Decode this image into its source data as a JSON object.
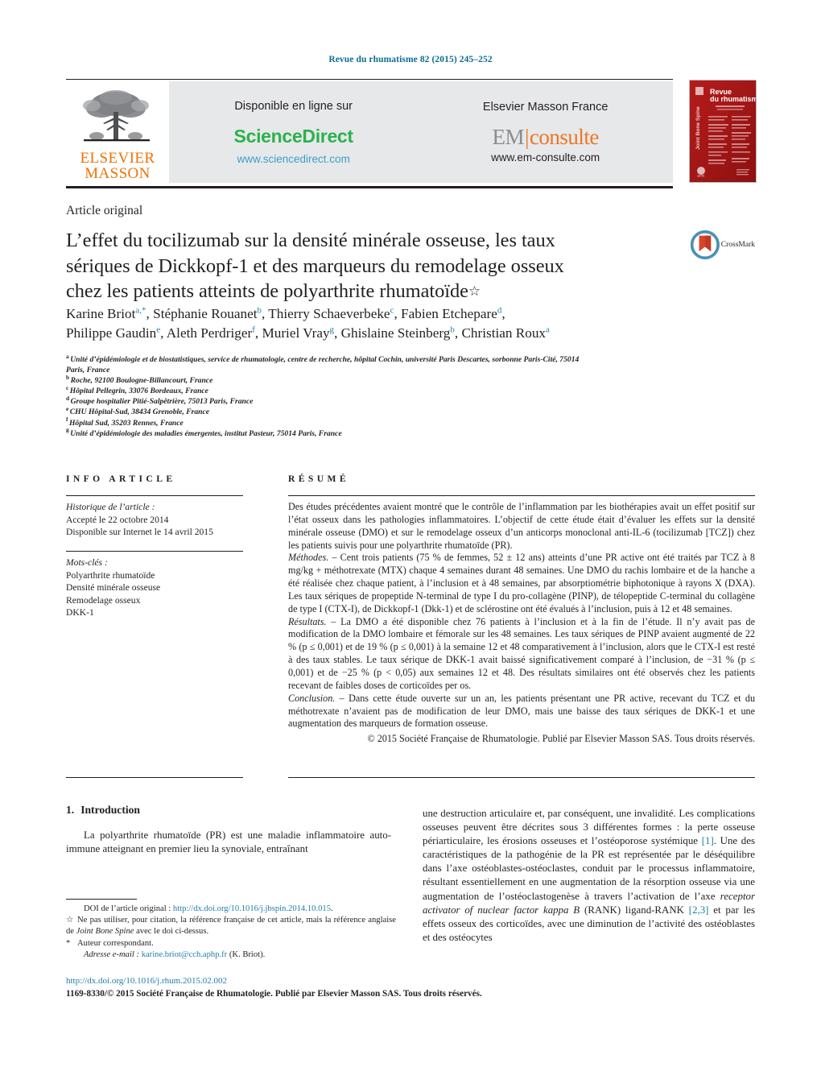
{
  "running_head": "Revue du rhumatisme 82 (2015) 245–252",
  "header": {
    "publisher_logo_lines": [
      "ELSEVIER",
      "MASSON"
    ],
    "available_online_label": "Disponible en ligne sur",
    "sciencedirect_label": "ScienceDirect",
    "sciencedirect_url": "www.sciencedirect.com",
    "elsevier_masson_france_label": "Elsevier Masson France",
    "em_logo_em": "EM",
    "em_logo_consulte": "consulte",
    "emconsulte_url": "www.em-consulte.com",
    "cover_title_line1": "Revue",
    "cover_title_line2": "du rhumatisme",
    "cover_spine": "Joint Bone Spine"
  },
  "article_type": "Article original",
  "title": "L’effet du tocilizumab sur la densité minérale osseuse, les taux sériques de Dickkopf-1 et des marqueurs du remodelage osseux chez les patients atteints de polyarthrite rhumatoïde",
  "title_footnote_marker": "☆",
  "crossmark_label": "CrossMark",
  "authors": [
    {
      "name": "Karine Briot",
      "sup": "a,*"
    },
    {
      "name": "Stéphanie Rouanet",
      "sup": "b"
    },
    {
      "name": "Thierry Schaeverbeke",
      "sup": "c"
    },
    {
      "name": "Fabien Etchepare",
      "sup": "d"
    },
    {
      "name": "Philippe Gaudin",
      "sup": "e"
    },
    {
      "name": "Aleth Perdriger",
      "sup": "f"
    },
    {
      "name": "Muriel Vray",
      "sup": "g"
    },
    {
      "name": "Ghislaine Steinberg",
      "sup": "b"
    },
    {
      "name": "Christian Roux",
      "sup": "a"
    }
  ],
  "affiliations": [
    {
      "marker": "a",
      "text": "Unité d’épidémiologie et de biostatistiques, service de rhumatologie, centre de recherche, hôpital Cochin, université Paris Descartes, sorbonne Paris-Cité, 75014 Paris, France"
    },
    {
      "marker": "b",
      "text": "Roche, 92100 Boulogne-Billancourt, France"
    },
    {
      "marker": "c",
      "text": "Hôpital Pellegrin, 33076 Bordeaux, France"
    },
    {
      "marker": "d",
      "text": "Groupe hospitalier Pitié-Salpêtrière, 75013 Paris, France"
    },
    {
      "marker": "e",
      "text": "CHU Hôpital-Sud, 38434 Grenoble, France"
    },
    {
      "marker": "f",
      "text": "Hôpital Sud, 35203 Rennes, France"
    },
    {
      "marker": "g",
      "text": "Unité d’épidémiologie des maladies émergentes, institut Pasteur, 75014 Paris, France"
    }
  ],
  "info_article": {
    "heading": "INFO ARTICLE",
    "history_label": "Historique de l’article :",
    "history_lines": [
      "Accepté le 22 octobre 2014",
      "Disponible sur Internet le 14 avril 2015"
    ],
    "keywords_label": "Mots-clés :",
    "keywords": [
      "Polyarthrite rhumatoïde",
      "Densité minérale osseuse",
      "Remodelage osseux",
      "DKK-1"
    ]
  },
  "resume": {
    "heading": "RÉSUMÉ",
    "intro": "Des études précédentes avaient montré que le contrôle de l’inflammation par les biothérapies avait un effet positif sur l’état osseux dans les pathologies inflammatoires. L’objectif de cette étude était d’évaluer les effets sur la densité minérale osseuse (DMO) et sur le remodelage osseux d’un anticorps monoclonal anti-IL-6 (tocilizumab [TCZ]) chez les patients suivis pour une polyarthrite rhumatoïde (PR).",
    "methods_label": "Méthodes. –",
    "methods": " Cent trois patients (75 % de femmes, 52 ± 12 ans) atteints d’une PR active ont été traités par TCZ à 8 mg/kg + méthotrexate (MTX) chaque 4 semaines durant 48 semaines. Une DMO du rachis lombaire et de la hanche a été réalisée chez chaque patient, à l’inclusion et à 48 semaines, par absorptiométrie biphotonique à rayons X (DXA). Les taux sériques de propeptide N-terminal de type I du pro-collagène (PINP), de télopeptide C-terminal du collagène de type I (CTX-I), de Dickkopf-1 (Dkk-1) et de sclérostine ont été évalués à l’inclusion, puis à 12 et 48 semaines.",
    "results_label": "Résultats. –",
    "results": " La DMO a été disponible chez 76 patients à l’inclusion et à la fin de l’étude. Il n’y avait pas de modification de la DMO lombaire et fémorale sur les 48 semaines. Les taux sériques de PINP avaient augmenté de 22 % (p ≤ 0,001) et de 19 % (p ≤ 0,001) à la semaine 12 et 48 comparativement à l’inclusion, alors que le CTX-I est resté à des taux stables. Le taux sérique de DKK-1 avait baissé significativement comparé à l’inclusion, de −31 % (p ≤ 0,001) et de −25 % (p < 0,05) aux semaines 12 et 48. Des résultats similaires ont été observés chez les patients recevant de faibles doses de corticoïdes per os.",
    "conclusion_label": "Conclusion. –",
    "conclusion": " Dans cette étude ouverte sur un an, les patients présentant une PR active, recevant du TCZ et du méthotrexate n’avaient pas de modification de leur DMO, mais une baisse des taux sériques de DKK-1 et une augmentation des marqueurs de formation osseuse.",
    "copyright": "© 2015 Société Française de Rhumatologie. Publié par Elsevier Masson SAS. Tous droits réservés."
  },
  "body": {
    "section_number": "1.",
    "section_title": "Introduction",
    "left_paragraph": "La polyarthrite rhumatoïde (PR) est une maladie inflammatoire auto-immune atteignant en premier lieu la synoviale, entraînant",
    "right_part1": "une destruction articulaire et, par conséquent, une invalidité. Les complications osseuses peuvent être décrites sous 3 différentes formes : la perte osseuse périarticulaire, les érosions osseuses et l’ostéoporose systémique ",
    "right_ref1": "[1]",
    "right_part2": ". Une des caractéristiques de la pathogénie de la PR est représentée par le déséquilibre dans l’axe ostéoblastes-ostéoclastes, conduit par le processus inflammatoire, résultant essentiellement en une augmentation de la résorption osseuse via une augmentation de l’ostéoclastogenèse à travers l’activation de l’axe ",
    "right_italic": "receptor activator of nuclear factor kappa B",
    "right_part3": " (RANK) ligand-RANK ",
    "right_ref2": "[2,3]",
    "right_part4": " et par les effets osseux des corticoïdes, avec une diminution de l’activité des ostéoblastes et des ostéocytes"
  },
  "footnotes": {
    "doi_original_label": "DOI de l’article original : ",
    "doi_original_url": "http://dx.doi.org/10.1016/j.jbspin.2014.10.015",
    "doi_original_end": ".",
    "star_marker": "☆",
    "star_text_1": "Ne pas utiliser, pour citation, la référence française de cet article, mais la référence anglaise de ",
    "star_text_italic": "Joint Bone Spine",
    "star_text_2": " avec le doi ci-dessus.",
    "corresponding_marker": "*",
    "corresponding_text": "Auteur correspondant.",
    "email_label": "Adresse e-mail : ",
    "email": "karine.briot@cch.aphp.fr",
    "email_suffix": " (K. Briot)."
  },
  "bottom": {
    "doi": "http://dx.doi.org/10.1016/j.rhum.2015.02.002",
    "copyright": "1169-8330/© 2015 Société Française de Rhumatologie. Publié par Elsevier Masson SAS. Tous droits réservés."
  },
  "colors": {
    "link": "#1f7ea8",
    "running_head": "#0b6d8f",
    "sciencedirect_green": "#2bb24c",
    "elsevier_orange": "#ec7404",
    "consulte_orange": "#ee7624",
    "panel_grey": "#e7e8ea",
    "cover_red": "#aa1111"
  }
}
